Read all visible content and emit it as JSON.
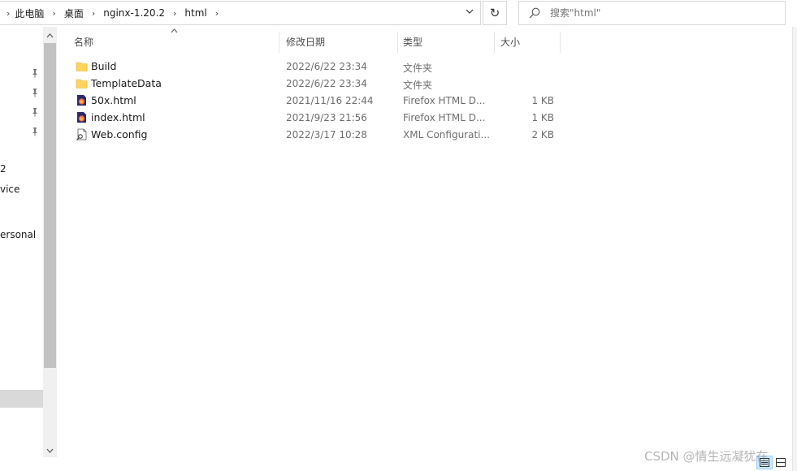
{
  "breadcrumb": {
    "items": [
      "此电脑",
      "桌面",
      "nginx-1.20.2",
      "html"
    ]
  },
  "search": {
    "placeholder": "搜索\"html\""
  },
  "nav": {
    "items": [
      {
        "label": "2"
      },
      {
        "label": "vice"
      },
      {
        "label": "ersonal"
      }
    ]
  },
  "columns": {
    "name": "名称",
    "modified": "修改日期",
    "type": "类型",
    "size": "大小"
  },
  "files": [
    {
      "name": "Build",
      "modified": "2022/6/22 23:34",
      "type": "文件夹",
      "size": "",
      "icon": "folder-icon"
    },
    {
      "name": "TemplateData",
      "modified": "2022/6/22 23:34",
      "type": "文件夹",
      "size": "",
      "icon": "folder-icon"
    },
    {
      "name": "50x.html",
      "modified": "2021/11/16 22:44",
      "type": "Firefox HTML D...",
      "size": "1 KB",
      "icon": "firefox-html-icon"
    },
    {
      "name": "index.html",
      "modified": "2021/9/23 21:56",
      "type": "Firefox HTML D...",
      "size": "1 KB",
      "icon": "firefox-html-icon"
    },
    {
      "name": "Web.config",
      "modified": "2022/3/17 10:28",
      "type": "XML Configurati...",
      "size": "2 KB",
      "icon": "config-file-icon"
    }
  ],
  "watermark": "CSDN @情生远凝犹在",
  "colors": {
    "folder": "#ffd45e",
    "selection": "#cce8ff"
  }
}
